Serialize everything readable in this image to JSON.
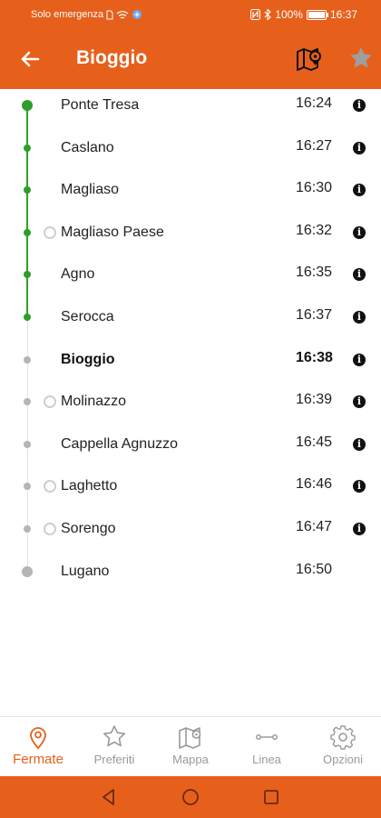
{
  "status_bar": {
    "carrier": "Solo emergenza",
    "battery": "100%",
    "battery_level": 1.0,
    "time": "16:37",
    "icons": [
      "nfc-icon",
      "bluetooth-icon",
      "battery-icon",
      "sim-icon",
      "wifi-icon",
      "vpn-icon"
    ]
  },
  "app_bar": {
    "title": "Bioggio",
    "back_icon": "arrow-left-icon",
    "map_icon": "map-pin-icon",
    "favorite_icon": "star-icon"
  },
  "stops": [
    {
      "name": "Ponte Tresa",
      "time": "16:24",
      "status": "passed",
      "terminal": true,
      "marker": false,
      "info": true
    },
    {
      "name": "Caslano",
      "time": "16:27",
      "status": "passed",
      "terminal": false,
      "marker": false,
      "info": true
    },
    {
      "name": "Magliaso",
      "time": "16:30",
      "status": "passed",
      "terminal": false,
      "marker": false,
      "info": true
    },
    {
      "name": "Magliaso Paese",
      "time": "16:32",
      "status": "passed",
      "terminal": false,
      "marker": true,
      "info": true
    },
    {
      "name": "Agno",
      "time": "16:35",
      "status": "passed",
      "terminal": false,
      "marker": false,
      "info": true
    },
    {
      "name": "Serocca",
      "time": "16:37",
      "status": "passed",
      "terminal": false,
      "marker": false,
      "info": true
    },
    {
      "name": "Bioggio",
      "time": "16:38",
      "status": "current",
      "terminal": false,
      "marker": false,
      "info": true
    },
    {
      "name": "Molinazzo",
      "time": "16:39",
      "status": "upcoming",
      "terminal": false,
      "marker": true,
      "info": true
    },
    {
      "name": "Cappella Agnuzzo",
      "time": "16:45",
      "status": "upcoming",
      "terminal": false,
      "marker": false,
      "info": true
    },
    {
      "name": "Laghetto",
      "time": "16:46",
      "status": "upcoming",
      "terminal": false,
      "marker": true,
      "info": true
    },
    {
      "name": "Sorengo",
      "time": "16:47",
      "status": "upcoming",
      "terminal": false,
      "marker": true,
      "info": true
    },
    {
      "name": "Lugano",
      "time": "16:50",
      "status": "upcoming",
      "terminal": true,
      "marker": false,
      "info": false
    }
  ],
  "info_glyph": "i",
  "bottom_nav": {
    "items": [
      {
        "label": "Fermate",
        "icon": "location-pin-icon",
        "active": true
      },
      {
        "label": "Preferiti",
        "icon": "star-outline-icon",
        "active": false
      },
      {
        "label": "Mappa",
        "icon": "map-icon",
        "active": false
      },
      {
        "label": "Linea",
        "icon": "line-icon",
        "active": false
      },
      {
        "label": "Opzioni",
        "icon": "gear-icon",
        "active": false
      }
    ]
  },
  "system_nav": {
    "icons": [
      "back-triangle-icon",
      "home-circle-icon",
      "recents-square-icon"
    ]
  },
  "colors": {
    "accent": "#e6601c",
    "passed": "#2e9e2a",
    "upcoming": "#b5b5b5",
    "inactive_label": "#9a9a9a"
  }
}
